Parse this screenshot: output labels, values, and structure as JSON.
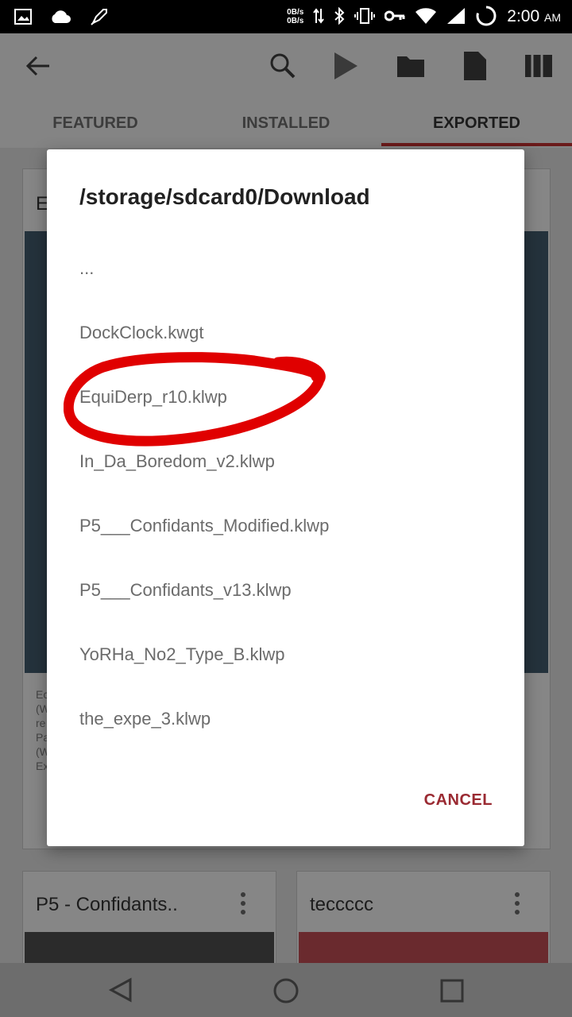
{
  "status_bar": {
    "net_up": "0B/s",
    "net_down": "0B/s",
    "time": "2:00",
    "ampm": "AM",
    "icons": [
      "image-icon",
      "cloud-icon",
      "rocket-icon",
      "data-arrows-icon",
      "bluetooth-icon",
      "vibrate-icon",
      "key-icon",
      "wifi-icon",
      "signal-icon",
      "battery-ring-icon"
    ]
  },
  "toolbar": {
    "icons": [
      "back-arrow-icon",
      "search-icon",
      "play-store-icon",
      "folder-icon",
      "file-icon",
      "library-icon"
    ]
  },
  "tabs": [
    {
      "label": "FEATURED"
    },
    {
      "label": "INSTALLED"
    },
    {
      "label": "EXPORTED"
    }
  ],
  "background_cards": [
    {
      "title": "E"
    },
    {
      "title": "P5 - Confidants.."
    },
    {
      "title": "teccccc"
    }
  ],
  "background_texts": [
    "Ec",
    "(W",
    "re",
    "Pa",
    "(W",
    "Ex"
  ],
  "dialog": {
    "title": "/storage/sdcard0/Download",
    "items": [
      "...",
      "DockClock.kwgt",
      "EquiDerp_r10.klwp",
      "In_Da_Boredom_v2.klwp",
      "P5___Confidants_Modified.klwp",
      "P5___Confidants_v13.klwp",
      "YoRHa_No2_Type_B.klwp",
      "the_expe_3.klwp"
    ],
    "cancel_label": "CANCEL"
  },
  "annotation_color": "#e00000",
  "accent_color": "#9a2a32"
}
